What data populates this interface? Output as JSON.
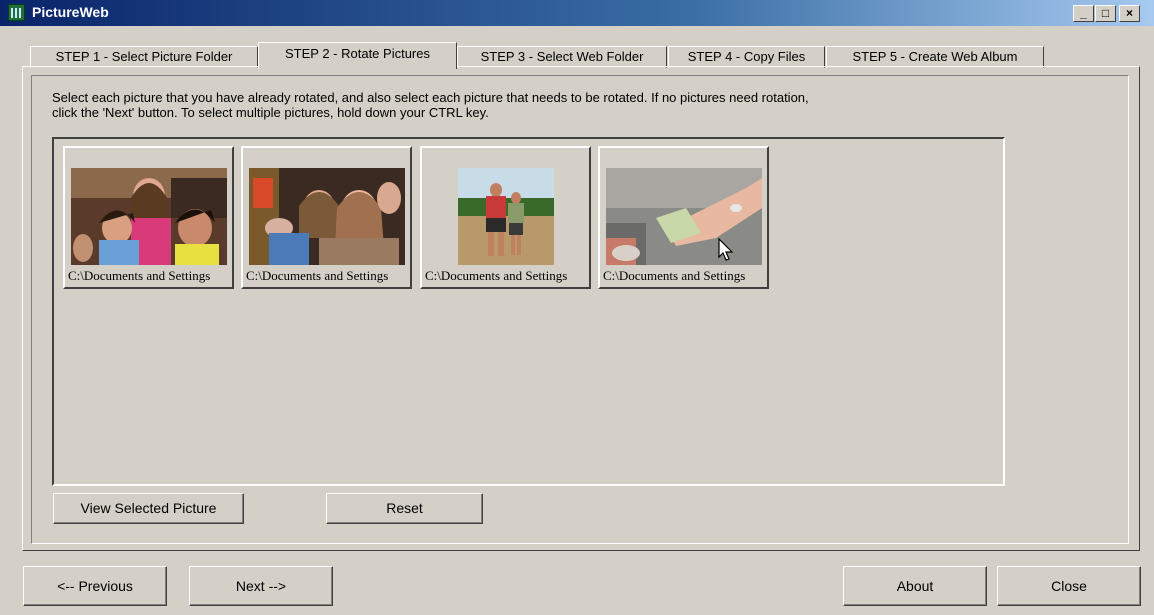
{
  "window": {
    "title": "PictureWeb",
    "minimize_label": "_",
    "maximize_label": "□",
    "close_label": "×"
  },
  "tabs": [
    {
      "label": "STEP 1 - Select Picture Folder",
      "active": false
    },
    {
      "label": "STEP 2 - Rotate Pictures",
      "active": true
    },
    {
      "label": "STEP 3 - Select Web Folder",
      "active": false
    },
    {
      "label": "STEP 4 - Copy Files",
      "active": false
    },
    {
      "label": "STEP 5 - Create Web Album",
      "active": false
    }
  ],
  "instructions": {
    "line1": "Select each picture that you have already rotated, and also select each picture that needs to be rotated. If no pictures need rotation,",
    "line2": "click the 'Next' button. To select multiple pictures, hold down your CTRL key."
  },
  "thumbnails": [
    {
      "caption": "C:\\Documents and Settings"
    },
    {
      "caption": "C:\\Documents and Settings"
    },
    {
      "caption": "C:\\Documents and Settings"
    },
    {
      "caption": "C:\\Documents and Settings"
    }
  ],
  "panel_buttons": {
    "view_selected": "View Selected Picture",
    "reset": "Reset"
  },
  "nav_buttons": {
    "previous": "<-- Previous",
    "next": "Next -->",
    "about": "About",
    "close": "Close"
  },
  "icons": {
    "app": "pictureweb-app-icon",
    "cursor": "mouse-pointer-icon"
  }
}
